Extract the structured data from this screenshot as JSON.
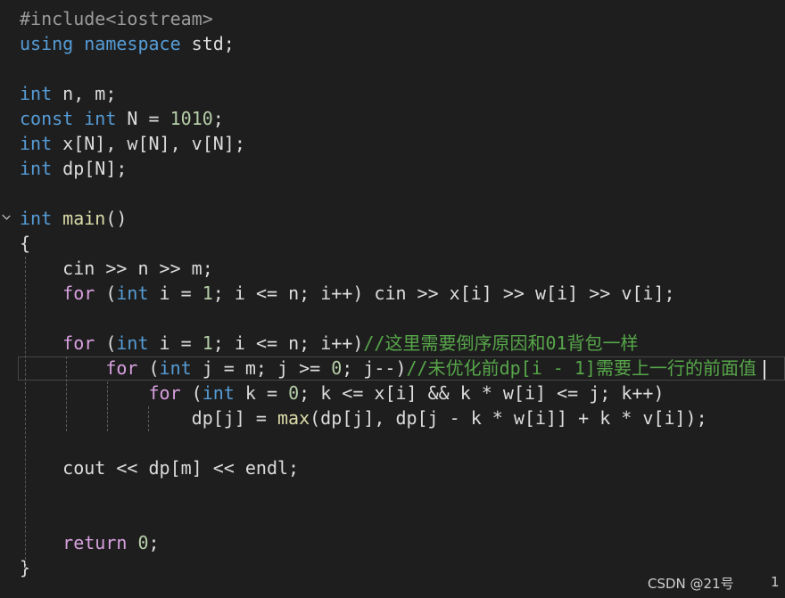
{
  "editor": {
    "lines": [
      [
        {
          "c": "pp",
          "t": "#include<iostream>"
        }
      ],
      [
        {
          "c": "kw",
          "t": "using"
        },
        {
          "c": "",
          "t": " "
        },
        {
          "c": "kw",
          "t": "namespace"
        },
        {
          "c": "",
          "t": " std;"
        }
      ],
      [],
      [
        {
          "c": "kw",
          "t": "int"
        },
        {
          "c": "",
          "t": " n, m;"
        }
      ],
      [
        {
          "c": "kw",
          "t": "const"
        },
        {
          "c": "",
          "t": " "
        },
        {
          "c": "kw",
          "t": "int"
        },
        {
          "c": "",
          "t": " N = "
        },
        {
          "c": "num",
          "t": "1010"
        },
        {
          "c": "",
          "t": ";"
        }
      ],
      [
        {
          "c": "kw",
          "t": "int"
        },
        {
          "c": "",
          "t": " x[N], w[N], v[N];"
        }
      ],
      [
        {
          "c": "kw",
          "t": "int"
        },
        {
          "c": "",
          "t": " dp[N];"
        }
      ],
      [],
      [
        {
          "c": "kw",
          "t": "int"
        },
        {
          "c": "",
          "t": " "
        },
        {
          "c": "fn",
          "t": "main"
        },
        {
          "c": "",
          "t": "()"
        }
      ],
      [
        {
          "c": "",
          "t": "{"
        }
      ],
      [
        {
          "c": "",
          "t": "    cin >> n >> m;"
        }
      ],
      [
        {
          "c": "",
          "t": "    "
        },
        {
          "c": "ctrl",
          "t": "for"
        },
        {
          "c": "",
          "t": " ("
        },
        {
          "c": "kw",
          "t": "int"
        },
        {
          "c": "",
          "t": " i = "
        },
        {
          "c": "num",
          "t": "1"
        },
        {
          "c": "",
          "t": "; i <= n; i++) cin >> x[i] >> w[i] >> v[i];"
        }
      ],
      [],
      [
        {
          "c": "",
          "t": "    "
        },
        {
          "c": "ctrl",
          "t": "for"
        },
        {
          "c": "",
          "t": " ("
        },
        {
          "c": "kw",
          "t": "int"
        },
        {
          "c": "",
          "t": " i = "
        },
        {
          "c": "num",
          "t": "1"
        },
        {
          "c": "",
          "t": "; i <= n; i++)"
        },
        {
          "c": "cm",
          "t": "//这里需要倒序原因和01背包一样"
        }
      ],
      [
        {
          "c": "",
          "t": "        "
        },
        {
          "c": "ctrl",
          "t": "for"
        },
        {
          "c": "",
          "t": " ("
        },
        {
          "c": "kw",
          "t": "int"
        },
        {
          "c": "",
          "t": " j = m; j >= "
        },
        {
          "c": "num",
          "t": "0"
        },
        {
          "c": "",
          "t": "; j--)"
        },
        {
          "c": "cm",
          "t": "//未优化前dp[i - 1]需要上一行的前面值"
        }
      ],
      [
        {
          "c": "",
          "t": "            "
        },
        {
          "c": "ctrl",
          "t": "for"
        },
        {
          "c": "",
          "t": " ("
        },
        {
          "c": "kw",
          "t": "int"
        },
        {
          "c": "",
          "t": " k = "
        },
        {
          "c": "num",
          "t": "0"
        },
        {
          "c": "",
          "t": "; k <= x[i] && k * w[i] <= j; k++)"
        }
      ],
      [
        {
          "c": "",
          "t": "                dp[j] = "
        },
        {
          "c": "fn",
          "t": "max"
        },
        {
          "c": "",
          "t": "(dp[j], dp[j - k * w[i]] + k * v[i]);"
        }
      ],
      [],
      [
        {
          "c": "",
          "t": "    cout << dp[m] << endl;"
        }
      ],
      [],
      [],
      [
        {
          "c": "",
          "t": "    "
        },
        {
          "c": "ctrl",
          "t": "return"
        },
        {
          "c": "",
          "t": " "
        },
        {
          "c": "num",
          "t": "0"
        },
        {
          "c": "",
          "t": ";"
        }
      ],
      [
        {
          "c": "",
          "t": "}"
        }
      ]
    ]
  },
  "status": {
    "watermark": "CSDN @21号",
    "line_indicator": "1"
  }
}
